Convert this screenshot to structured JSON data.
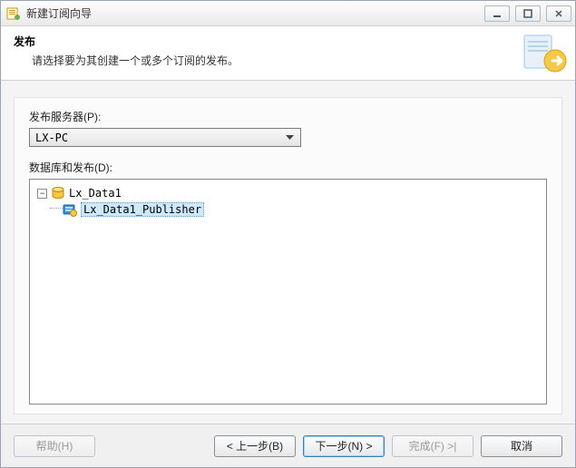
{
  "window": {
    "title": "新建订阅向导"
  },
  "header": {
    "title": "发布",
    "subtitle": "请选择要为其创建一个或多个订阅的发布。"
  },
  "publisher": {
    "label": "发布服务器(P):",
    "selected": "LX-PC"
  },
  "tree": {
    "label": "数据库和发布(D):",
    "items": [
      {
        "name": "Lx_Data1",
        "type": "database",
        "expanded": true,
        "children": [
          {
            "name": "Lx_Data1_Publisher",
            "type": "publication",
            "selected": true
          }
        ]
      }
    ]
  },
  "footer": {
    "help": "帮助(H)",
    "back": "< 上一步(B)",
    "next": "下一步(N) >",
    "finish": "完成(F) >|",
    "cancel": "取消"
  }
}
